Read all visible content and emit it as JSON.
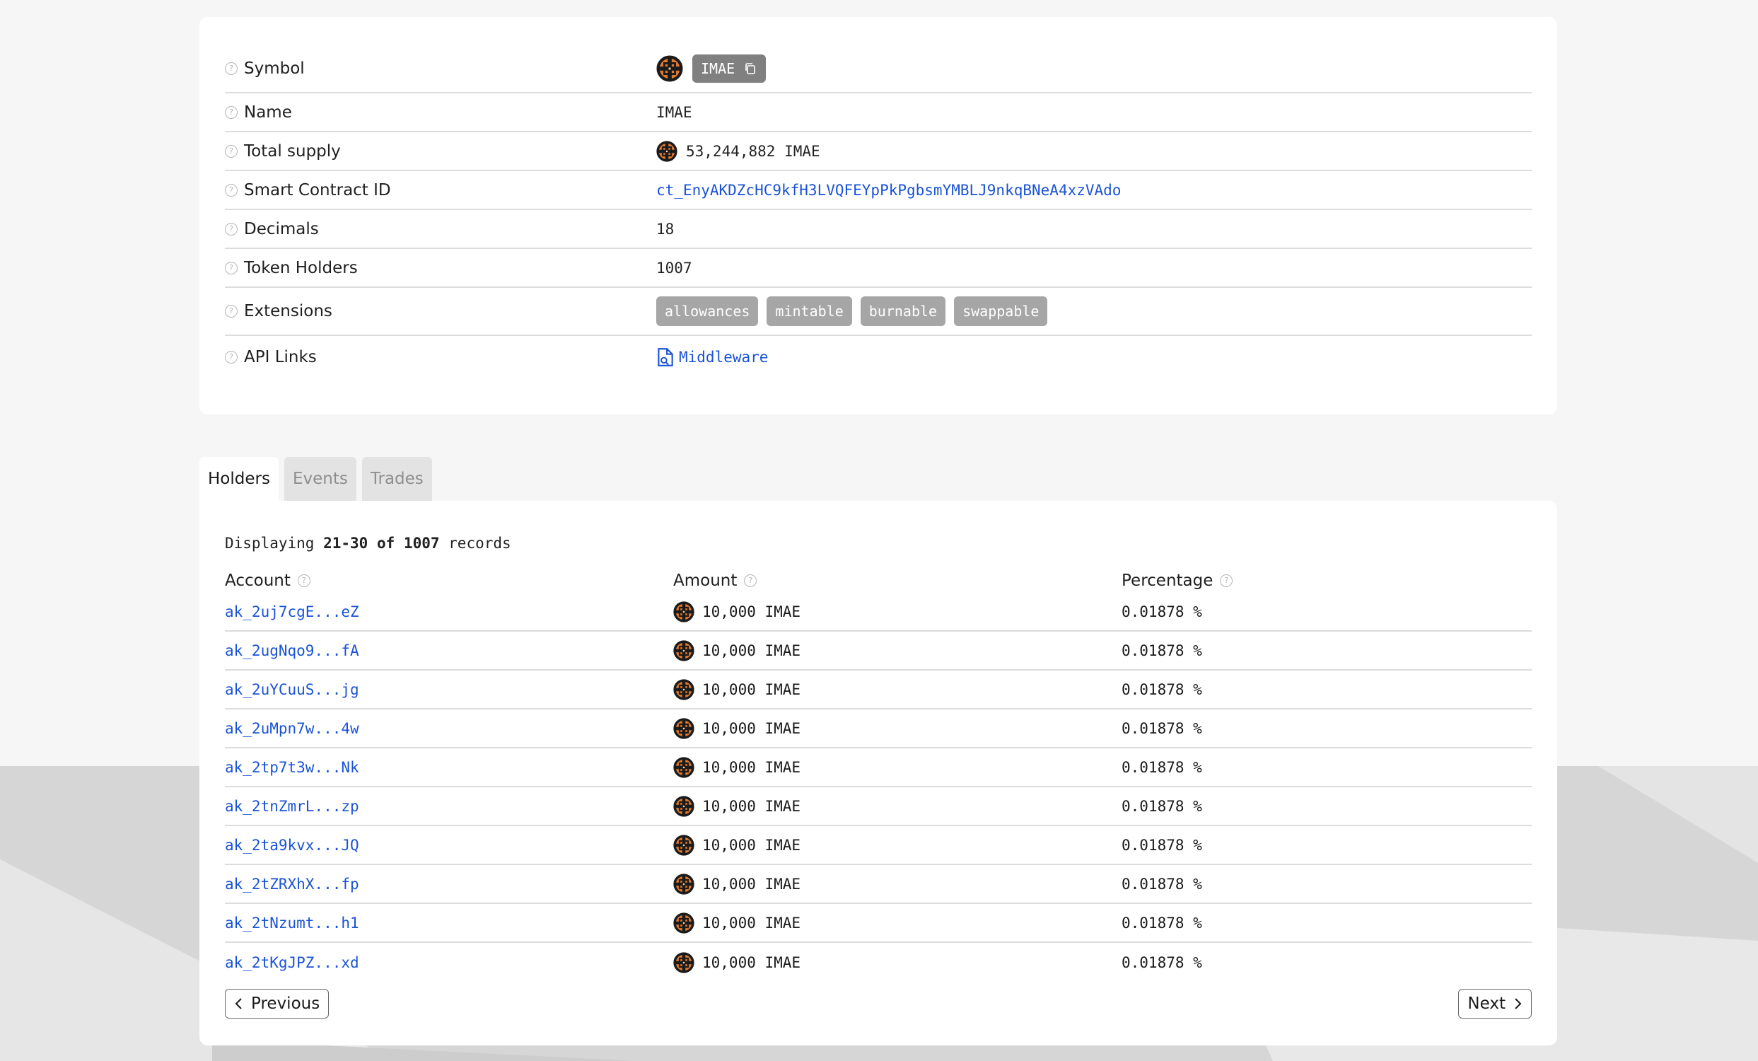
{
  "token": {
    "symbol": "IMAE",
    "name": "IMAE",
    "total_supply": "53,244,882 IMAE",
    "contract_id": "ct_EnyAKDZcHC9kfH3LVQFEYpPkPgbsmYMBLJ9nkqBNeA4xzVAdo",
    "decimals": "18",
    "holders_count": "1007",
    "extensions": [
      "allowances",
      "mintable",
      "burnable",
      "swappable"
    ],
    "api_link": "Middleware"
  },
  "labels": {
    "symbol": "Symbol",
    "name": "Name",
    "total_supply": "Total supply",
    "contract_id": "Smart Contract ID",
    "decimals": "Decimals",
    "holders": "Token Holders",
    "extensions": "Extensions",
    "api_links": "API Links"
  },
  "tabs": [
    {
      "label": "Holders",
      "active": true
    },
    {
      "label": "Events",
      "active": false
    },
    {
      "label": "Trades",
      "active": false
    }
  ],
  "holders_table": {
    "records_prefix": "Displaying",
    "records_range": "21-30",
    "records_of": "of",
    "records_total": "1007",
    "records_suffix": "records",
    "columns": [
      "Account",
      "Amount",
      "Percentage"
    ],
    "rows": [
      {
        "account": "ak_2uj7cgE...eZ",
        "amount": "10,000 IMAE",
        "percentage": "0.01878 %"
      },
      {
        "account": "ak_2ugNqo9...fA",
        "amount": "10,000 IMAE",
        "percentage": "0.01878 %"
      },
      {
        "account": "ak_2uYCuuS...jg",
        "amount": "10,000 IMAE",
        "percentage": "0.01878 %"
      },
      {
        "account": "ak_2uMpn7w...4w",
        "amount": "10,000 IMAE",
        "percentage": "0.01878 %"
      },
      {
        "account": "ak_2tp7t3w...Nk",
        "amount": "10,000 IMAE",
        "percentage": "0.01878 %"
      },
      {
        "account": "ak_2tnZmrL...zp",
        "amount": "10,000 IMAE",
        "percentage": "0.01878 %"
      },
      {
        "account": "ak_2ta9kvx...JQ",
        "amount": "10,000 IMAE",
        "percentage": "0.01878 %"
      },
      {
        "account": "ak_2tZRXhX...fp",
        "amount": "10,000 IMAE",
        "percentage": "0.01878 %"
      },
      {
        "account": "ak_2tNzumt...h1",
        "amount": "10,000 IMAE",
        "percentage": "0.01878 %"
      },
      {
        "account": "ak_2tKgJPZ...xd",
        "amount": "10,000 IMAE",
        "percentage": "0.01878 %"
      }
    ]
  },
  "pagination": {
    "previous": "Previous",
    "next": "Next"
  },
  "icons": {
    "help": "question-circle-icon",
    "token": "token-logo-icon",
    "copy": "copy-icon",
    "api": "document-link-icon",
    "prev": "chevron-left-icon",
    "next": "chevron-right-icon"
  },
  "colors": {
    "link": "#1a53d8",
    "symbol_badge": "#808080",
    "extension_badge": "#a6a6a6",
    "page_bg": "#f6f6f6",
    "card_bg": "#ffffff"
  }
}
